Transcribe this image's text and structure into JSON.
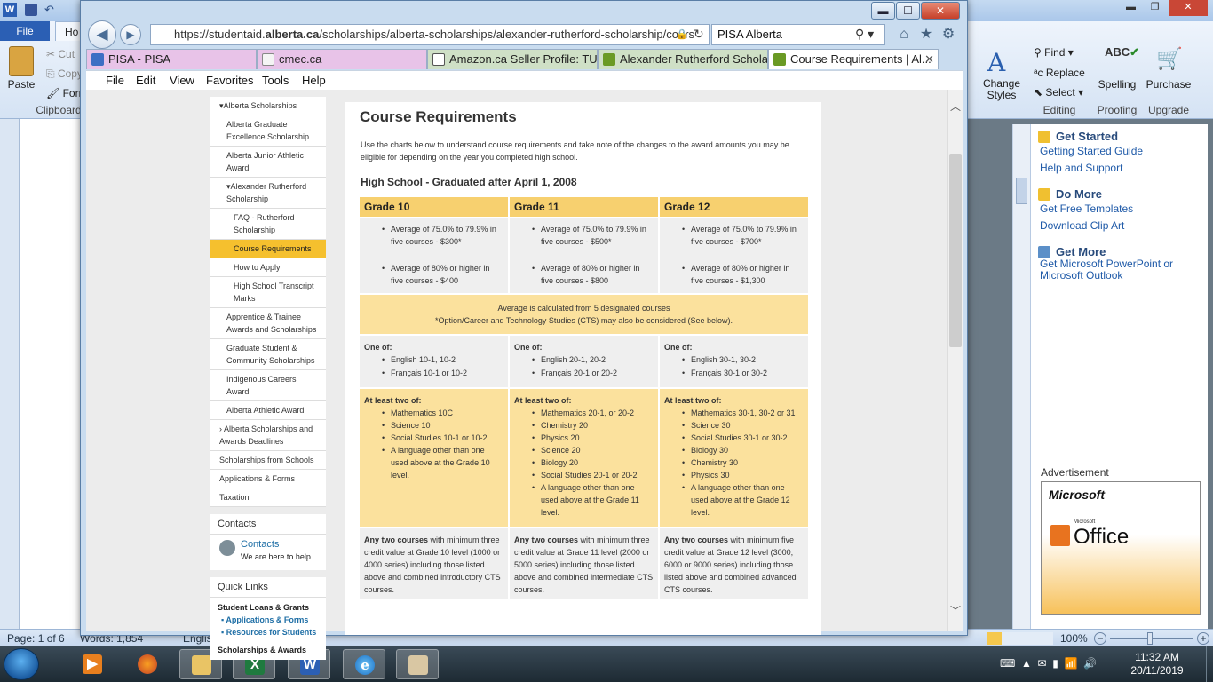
{
  "word": {
    "file_tab": "File",
    "home_tab": "Ho",
    "clipboard_items": [
      "Cut",
      "Copy",
      "Forma"
    ],
    "paste_label": "Paste",
    "clipboard_label": "Clipboard",
    "change_styles": "Change Styles",
    "find": "Find",
    "replace": "Replace",
    "select": "Select",
    "editing_label": "Editing",
    "spelling": "Spelling",
    "proofing_label": "Proofing",
    "purchase": "Purchase",
    "upgrade_label": "Upgrade",
    "status_page": "Page: 1 of 6",
    "status_words": "Words: 1,854",
    "status_lang": "English (Canada)",
    "zoom": "100%",
    "task_pane": {
      "get_started": "Get Started",
      "get_started_links": [
        "Getting Started Guide",
        "Help and Support"
      ],
      "do_more": "Do More",
      "do_more_links": [
        "Get Free Templates",
        "Download Clip Art"
      ],
      "get_more": "Get More",
      "get_more_links": [
        "Get Microsoft PowerPoint or Microsoft Outlook"
      ],
      "advertisement": "Advertisement",
      "ad_brand": "Microsoft",
      "ad_product": "Office",
      "ad_small": "Microsoft"
    }
  },
  "taskbar": {
    "time": "11:32 AM",
    "date": "20/11/2019",
    "app_glyphs": [
      "X",
      "W"
    ]
  },
  "ie": {
    "url_prefix": "https://studentaid.",
    "url_domain": "alberta.ca",
    "url_suffix": "/scholarships/alberta-scholarships/alexander-rutherford-scholarship/cours",
    "search": "PISA Alberta",
    "tabs": [
      "PISA - PISA",
      "cmec.ca",
      "Amazon.ca Seller Profile: TUR...",
      "Alexander Rutherford Scholar...",
      "Course Requirements | Al..."
    ],
    "menu": [
      "File",
      "Edit",
      "View",
      "Favorites",
      "Tools",
      "Help"
    ]
  },
  "nav": {
    "items": [
      "Alberta Scholarships",
      "Alberta Graduate Excellence Scholarship",
      "Alberta Junior Athletic Award",
      "Alexander Rutherford Scholarship",
      "FAQ - Rutherford Scholarship",
      "Course Requirements",
      "How to Apply",
      "High School Transcript Marks",
      "Apprentice & Trainee Awards and Scholarships",
      "Graduate Student & Community Scholarships",
      "Indigenous Careers Award",
      "Alberta Athletic Award",
      "Alberta Scholarships and Awards Deadlines",
      "Scholarships from Schools",
      "Applications & Forms",
      "Taxation"
    ],
    "contacts_heading": "Contacts",
    "contacts_link": "Contacts",
    "contacts_sub": "We are here to help.",
    "quick_links": "Quick Links",
    "ql_group": "Student Loans & Grants",
    "ql_items": [
      "Applications & Forms",
      "Resources for Students"
    ],
    "ql_group2": "Scholarships & Awards"
  },
  "page": {
    "title": "Course Requirements",
    "intro": "Use the charts below to understand course requirements and take note of the changes to the award amounts you may be eligible for depending on the year you completed high school.",
    "subtitle": "High School - Graduated after April 1, 2008",
    "grades": [
      "Grade 10",
      "Grade 11",
      "Grade 12"
    ],
    "averages": [
      [
        "Average of 75.0% to 79.9% in five courses - $300*",
        "Average of 80% or higher in five courses - $400"
      ],
      [
        "Average of 75.0% to 79.9% in five courses - $500*",
        "Average of 80% or higher in five courses - $800"
      ],
      [
        "Average of 75.0% to 79.9% in five courses - $700*",
        "Average of 80% or higher in five courses - $1,300"
      ]
    ],
    "note1": "Average is calculated from 5 designated courses",
    "note2": "*Option/Career and Technology Studies (CTS) may also be considered (See below).",
    "one_of_label": "One of:",
    "one_of": [
      [
        "English 10-1, 10-2",
        "Français 10-1 or 10-2"
      ],
      [
        "English 20-1, 20-2",
        "Français 20-1 or 20-2"
      ],
      [
        "English 30-1, 30-2",
        "Français 30-1 or 30-2"
      ]
    ],
    "two_of_label": "At least two of:",
    "two_of": [
      [
        "Mathematics 10C",
        "Science 10",
        "Social Studies 10-1 or 10-2",
        "A language other than one used above at the Grade 10 level."
      ],
      [
        "Mathematics 20-1, or 20-2",
        "Chemistry 20",
        "Physics 20",
        "Science 20",
        "Biology 20",
        "Social Studies 20-1 or 20-2",
        "A language other than one used above at the Grade 11 level."
      ],
      [
        "Mathematics 30-1, 30-2 or 31",
        "Science 30",
        "Social Studies 30-1 or 30-2",
        "Biology 30",
        "Chemistry 30",
        "Physics 30",
        "A language other than one used above at the Grade 12 level."
      ]
    ],
    "any_two_bold": "Any two courses",
    "any_two": [
      " with minimum three credit value at Grade 10 level (1000 or 4000 series) including those listed above and combined introductory CTS courses.",
      " with minimum three credit value at Grade 11 level (2000 or 5000 series) including those listed above and combined intermediate CTS courses.",
      " with minimum five credit value at Grade 12 level (3000, 6000 or 9000 series) including those listed above and combined advanced CTS courses."
    ]
  }
}
